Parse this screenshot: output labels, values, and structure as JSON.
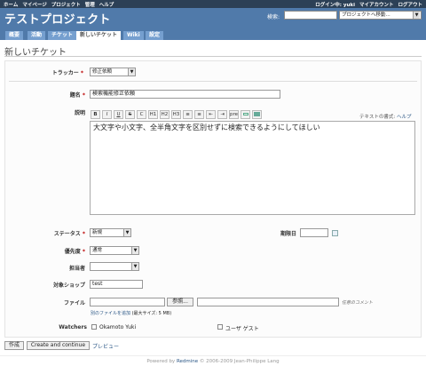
{
  "top_menu": {
    "left": [
      "ホーム",
      "マイページ",
      "プロジェクト",
      "管理",
      "ヘルプ"
    ],
    "right": [
      "ログイン中: yuki",
      "マイアカウント",
      "ログアウト"
    ]
  },
  "header": {
    "title": "テストプロジェクト",
    "search_label": "検索:",
    "jump_label": "プロジェクトへ移動..."
  },
  "tabs": [
    "概要",
    "活動",
    "チケット",
    "新しいチケット",
    "Wiki",
    "設定"
  ],
  "page_title": "新しいチケット",
  "form": {
    "tracker_label": "トラッカー",
    "tracker_value": "修正依頼",
    "subject_label": "題名",
    "subject_value": "検索機能修正依頼",
    "description_label": "説明",
    "description_value": "大文字や小文字、全半角文字を区別せずに検索できるようにしてほしい",
    "text_format_label": "テキストの書式:",
    "text_format_help": "ヘルプ",
    "toolbar": [
      "B",
      "I",
      "U",
      "S",
      "C",
      "H1",
      "H2",
      "H3",
      "≡",
      "≡",
      "⇤",
      "⇥",
      "pre",
      "",
      ""
    ],
    "status_label": "ステータス",
    "status_value": "新規",
    "priority_label": "優先度",
    "priority_value": "通常",
    "assignee_label": "担当者",
    "assignee_value": "",
    "due_label": "期限日",
    "target_label": "対象ショップ",
    "target_value": "test",
    "file_label": "ファイル",
    "browse_label": "参照...",
    "comment_placeholder": "任意のコメント",
    "add_file": "別のファイルを追加",
    "max_size": "(最大サイズ: 5 MB)",
    "watchers_label": "Watchers",
    "watchers": [
      "Okamoto Yuki",
      "ユーザ ゲスト"
    ]
  },
  "buttons": {
    "create": "作成",
    "create_continue": "Create and continue",
    "preview": "プレビュー"
  },
  "footer": {
    "powered": "Powered by",
    "brand": "Redmine",
    "copyright": "© 2006-2009 Jean-Philippe Lang"
  }
}
